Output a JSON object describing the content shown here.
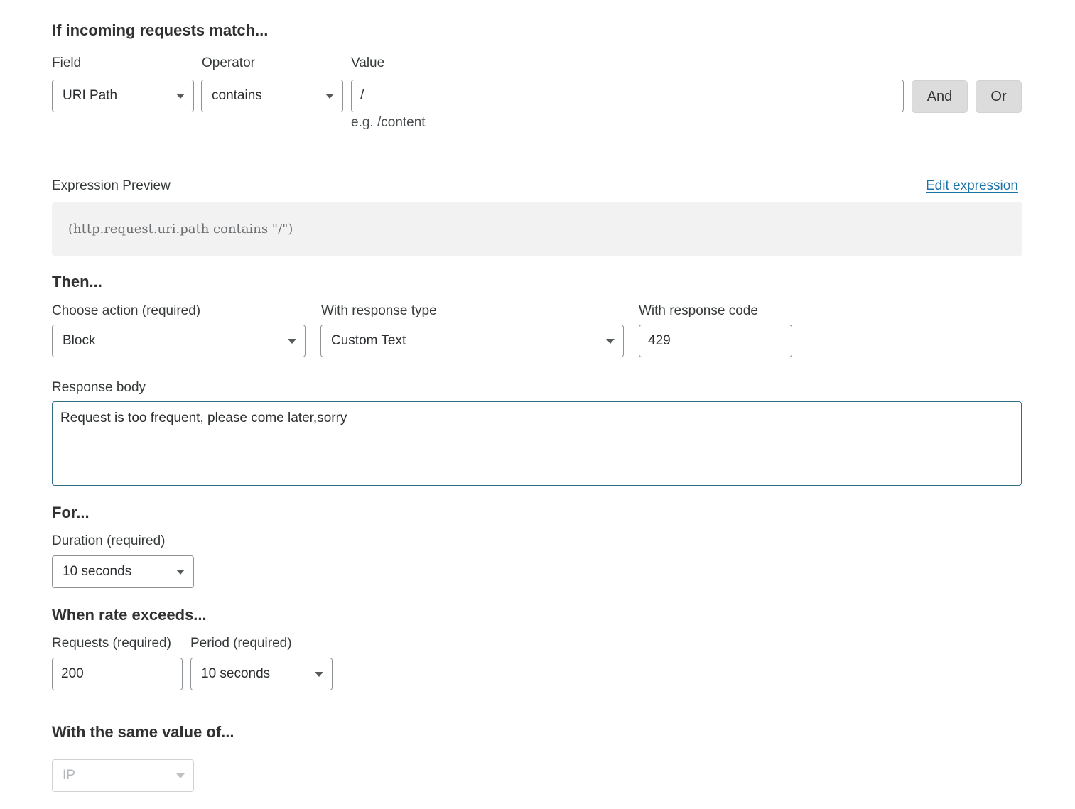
{
  "match_section": {
    "heading": "If incoming requests match...",
    "field_label": "Field",
    "operator_label": "Operator",
    "value_label": "Value",
    "field_value": "URI Path",
    "operator_value": "contains",
    "value_value": "/",
    "value_hint": "e.g. /content",
    "and_label": "And",
    "or_label": "Or"
  },
  "expression": {
    "label": "Expression Preview",
    "edit_link": "Edit expression",
    "preview": "(http.request.uri.path contains \"/\")"
  },
  "then_section": {
    "heading": "Then...",
    "action_label": "Choose action (required)",
    "action_value": "Block",
    "response_type_label": "With response type",
    "response_type_value": "Custom Text",
    "response_code_label": "With response code",
    "response_code_value": "429",
    "response_body_label": "Response body",
    "response_body_value": "Request is too frequent, please come later,sorry"
  },
  "for_section": {
    "heading": "For...",
    "duration_label": "Duration (required)",
    "duration_value": "10 seconds"
  },
  "rate_section": {
    "heading": "When rate exceeds...",
    "requests_label": "Requests (required)",
    "requests_value": "200",
    "period_label": "Period (required)",
    "period_value": "10 seconds"
  },
  "same_value_section": {
    "heading": "With the same value of...",
    "characteristic_value": "IP"
  },
  "colors": {
    "link": "#1a73a8",
    "focused_border": "#2f6f86",
    "button_bg": "#dcdcdc",
    "preview_bg": "#f2f2f2"
  }
}
